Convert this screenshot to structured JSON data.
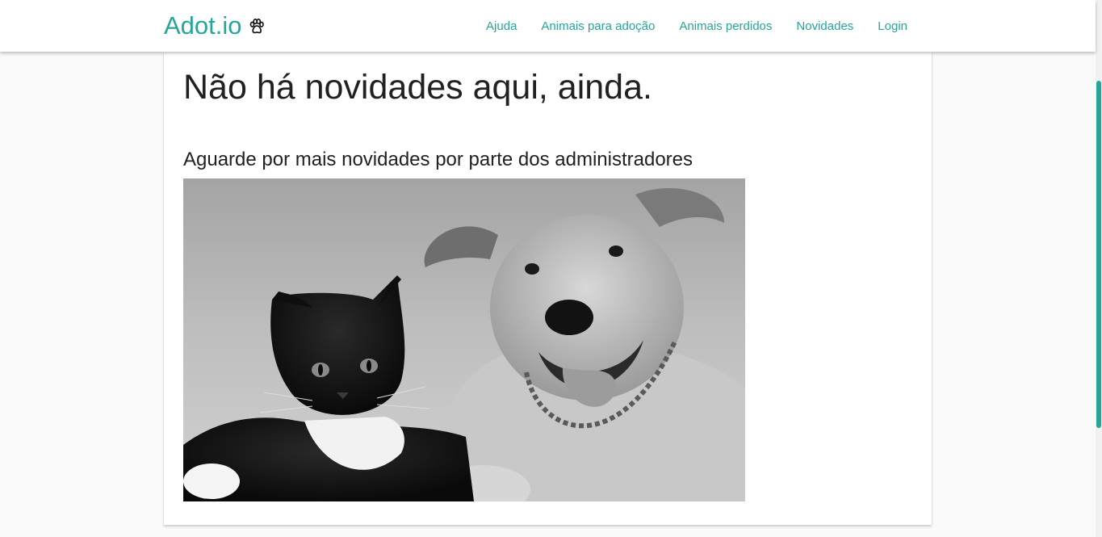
{
  "navbar": {
    "brand": "Adot.io",
    "brand_icon": "paw-icon",
    "links": [
      "Ajuda",
      "Animais para adoção",
      "Animais perdidos",
      "Novidades",
      "Login"
    ]
  },
  "main": {
    "title": "Não há novidades aqui, ainda.",
    "subtitle": "Aguarde por mais novidades por parte dos administradores",
    "image": "black-and-white photo of a cat and a dog"
  },
  "colors": {
    "accent": "#26a69a",
    "text": "#212121",
    "background": "#fafafa"
  }
}
